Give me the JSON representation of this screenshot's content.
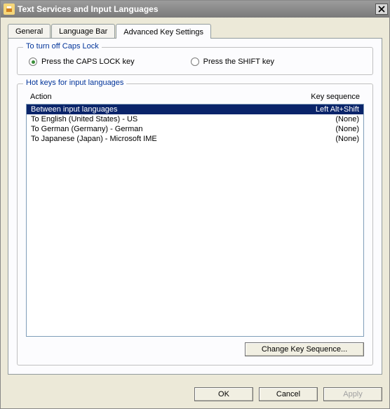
{
  "window": {
    "title": "Text Services and Input Languages"
  },
  "tabs": {
    "general": "General",
    "language_bar": "Language Bar",
    "advanced": "Advanced Key Settings"
  },
  "capslock_group": {
    "legend": "To turn off Caps Lock",
    "opt_caps": "Press the CAPS LOCK key",
    "opt_shift": "Press the SHIFT key"
  },
  "hotkeys_group": {
    "legend": "Hot keys for input languages",
    "col_action": "Action",
    "col_seq": "Key sequence"
  },
  "hotkeys": [
    {
      "action": "Between input languages",
      "seq": "Left Alt+Shift"
    },
    {
      "action": "To English (United States) - US",
      "seq": "(None)"
    },
    {
      "action": "To German (Germany) - German",
      "seq": "(None)"
    },
    {
      "action": "To Japanese (Japan) - Microsoft IME",
      "seq": "(None)"
    }
  ],
  "buttons": {
    "change_seq": "Change Key Sequence...",
    "ok": "OK",
    "cancel": "Cancel",
    "apply": "Apply"
  }
}
